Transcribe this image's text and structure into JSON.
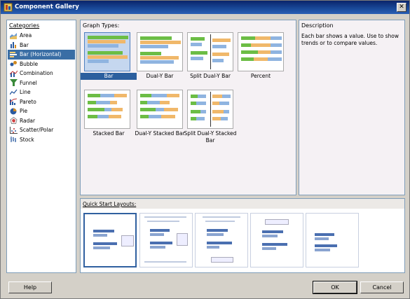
{
  "window": {
    "title": "Component Gallery",
    "close_glyph": "✕"
  },
  "categories": {
    "header": "Categories",
    "items": [
      {
        "label": "Area",
        "icon": "area-chart-icon"
      },
      {
        "label": "Bar",
        "icon": "bar-chart-icon"
      },
      {
        "label": "Bar (Horizontal)",
        "icon": "horizontal-bar-chart-icon",
        "selected": true
      },
      {
        "label": "Bubble",
        "icon": "bubble-chart-icon"
      },
      {
        "label": "Combination",
        "icon": "combination-chart-icon"
      },
      {
        "label": "Funnel",
        "icon": "funnel-chart-icon"
      },
      {
        "label": "Line",
        "icon": "line-chart-icon"
      },
      {
        "label": "Pareto",
        "icon": "pareto-chart-icon"
      },
      {
        "label": "Pie",
        "icon": "pie-chart-icon"
      },
      {
        "label": "Radar",
        "icon": "radar-chart-icon"
      },
      {
        "label": "Scatter/Polar",
        "icon": "scatter-chart-icon"
      },
      {
        "label": "Stock",
        "icon": "stock-chart-icon"
      }
    ]
  },
  "graph_types": {
    "header": "Graph Types:",
    "items": [
      {
        "label": "Bar",
        "selected": true
      },
      {
        "label": "Dual-Y Bar"
      },
      {
        "label": "Split Dual-Y Bar"
      },
      {
        "label": "Percent"
      },
      {
        "label": "Stacked Bar"
      },
      {
        "label": "Dual-Y Stacked Bar"
      },
      {
        "label": "Split Dual-Y Stacked Bar"
      }
    ]
  },
  "description": {
    "header": "Description",
    "text": "Each bar shows a value. Use to show trends or to compare values."
  },
  "quick_start": {
    "header": "Quick Start Layouts:"
  },
  "buttons": {
    "help": "Help",
    "ok": "OK",
    "cancel": "Cancel"
  },
  "colors": {
    "selection": "#3a6ea5",
    "title_bar": "#0a246a",
    "bar_green": "#6cbd45",
    "bar_orange": "#f0b86a",
    "bar_blue": "#8fb4e0"
  }
}
